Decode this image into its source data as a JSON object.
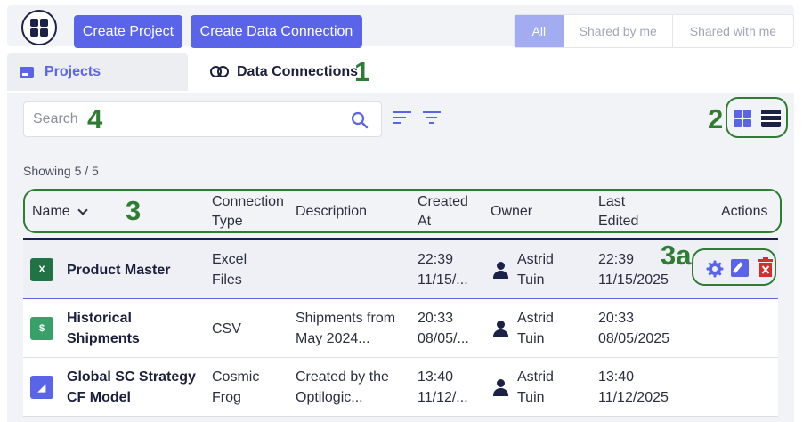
{
  "toolbar": {
    "create_project": "Create Project",
    "create_connection": "Create Data Connection",
    "filters": [
      "All",
      "Shared by me",
      "Shared with me"
    ]
  },
  "tabs": {
    "projects": "Projects",
    "data_connections": "Data Connections"
  },
  "search": {
    "placeholder": "Search"
  },
  "showing": "Showing 5 / 5",
  "table": {
    "headers": {
      "name": "Name",
      "type_1": "Connection",
      "type_2": "Type",
      "description": "Description",
      "created_1": "Created",
      "created_2": "At",
      "owner": "Owner",
      "edited_1": "Last",
      "edited_2": "Edited",
      "actions": "Actions"
    },
    "rows": [
      {
        "name_1": "Product Master",
        "name_2": "",
        "type_1": "Excel",
        "type_2": "Files",
        "desc_1": "",
        "desc_2": "",
        "created_1": "22:39",
        "created_2": "11/15/...",
        "owner_1": "Astrid",
        "owner_2": "Tuin",
        "edited_1": "22:39",
        "edited_2": "11/15/2025",
        "icon": "excel-icon"
      },
      {
        "name_1": "Historical",
        "name_2": "Shipments",
        "type_1": "CSV",
        "type_2": "",
        "desc_1": "Shipments from",
        "desc_2": "May 2024...",
        "created_1": "20:33",
        "created_2": "08/05/...",
        "owner_1": "Astrid",
        "owner_2": "Tuin",
        "edited_1": "20:33",
        "edited_2": "08/05/2025",
        "icon": "csv-icon"
      },
      {
        "name_1": "Global SC Strategy",
        "name_2": "CF Model",
        "type_1": "Cosmic",
        "type_2": "Frog",
        "desc_1": "Created by the",
        "desc_2": "Optilogic...",
        "created_1": "13:40",
        "created_2": "11/12/...",
        "owner_1": "Astrid",
        "owner_2": "Tuin",
        "edited_1": "13:40",
        "edited_2": "11/12/2025",
        "icon": "cosmic-frog-icon"
      }
    ]
  },
  "annotations": [
    "1",
    "2",
    "3",
    "3a",
    "4"
  ],
  "colors": {
    "accent": "#5a64e8",
    "dark": "#1c2147",
    "annotation": "#2e7d32"
  }
}
